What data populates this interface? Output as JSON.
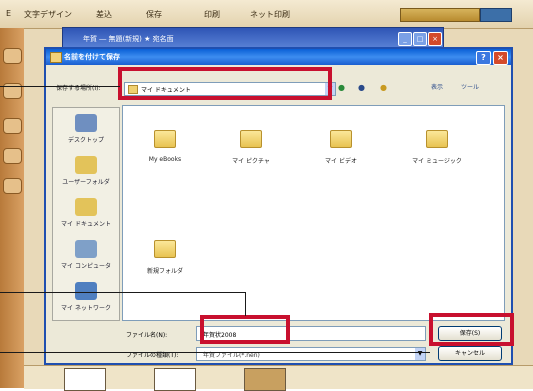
{
  "menubar": {
    "items": [
      "E",
      "文字デザイン",
      "差込",
      "保存",
      "印刷",
      "ネット印刷"
    ]
  },
  "background_window": {
    "title": "年賀 ― 無題(新規) ★ 宛名面"
  },
  "dialog": {
    "title": "名前を付けて保存",
    "help_label": "?",
    "close_label": "×",
    "lookin": {
      "label": "保存する場所(I):",
      "value": "マイ ドキュメント"
    },
    "toolbar": {
      "back": "●",
      "up": "●",
      "new_folder": "●",
      "views_label": "表示",
      "tools_label": "ツール"
    },
    "places": [
      {
        "label": "デスクトップ",
        "icon": "desktop-icon",
        "color": "#6f8fc0"
      },
      {
        "label": "ユーザーフォルダ",
        "icon": "user-folder-icon",
        "color": "#e3c35a"
      },
      {
        "label": "マイ ドキュメント",
        "icon": "my-documents-icon",
        "color": "#e3c35a"
      },
      {
        "label": "マイ コンピュータ",
        "icon": "my-computer-icon",
        "color": "#7fa0c8"
      },
      {
        "label": "マイ ネットワーク",
        "icon": "my-network-icon",
        "color": "#4f7fc0"
      }
    ],
    "files": [
      {
        "label": "My eBooks"
      },
      {
        "label": "マイ ピクチャ"
      },
      {
        "label": "マイ ビデオ"
      },
      {
        "label": "マイ ミュージック"
      },
      {
        "label": "新規フォルダ"
      }
    ],
    "filename": {
      "label": "ファイル名(N):",
      "value": "年賀状2008"
    },
    "filetype": {
      "label": "ファイルの種類(T):",
      "value": "年賀ファイル(*.nen)"
    },
    "save_button": "保存(S)",
    "cancel_button": "キャンセル"
  },
  "colors": {
    "highlight": "#c8102e",
    "dialog_title": "#1a5ed0"
  }
}
